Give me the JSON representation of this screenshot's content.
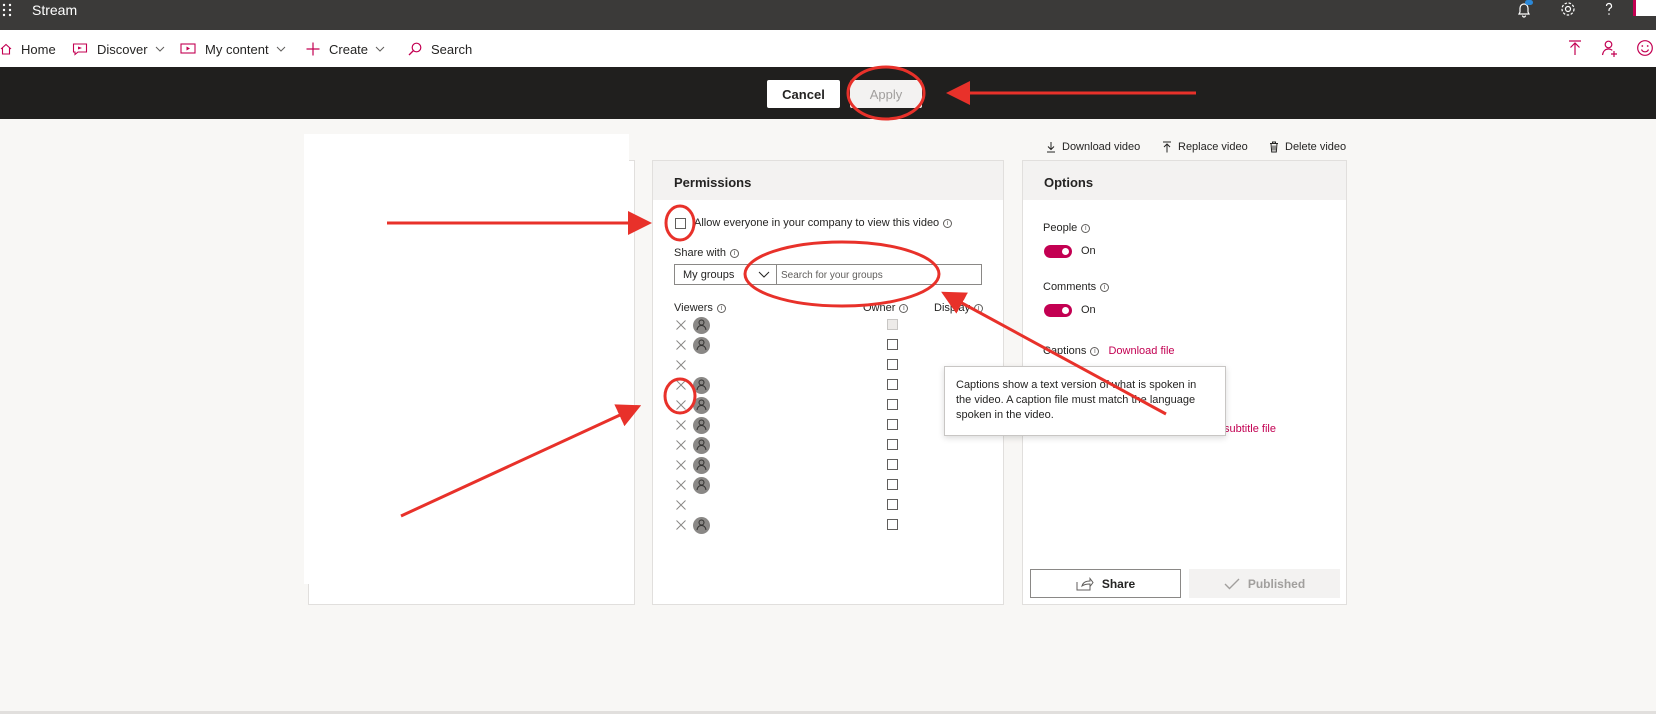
{
  "app": {
    "title": "Stream",
    "notification_count": "1"
  },
  "nav": {
    "home": "Home",
    "discover": "Discover",
    "my_content": "My content",
    "create": "Create",
    "search": "Search"
  },
  "command": {
    "cancel": "Cancel",
    "apply": "Apply"
  },
  "video_actions": {
    "download": "Download video",
    "replace": "Replace video",
    "delete": "Delete video"
  },
  "permissions": {
    "title": "Permissions",
    "allow_everyone": "Allow everyone in your company to view this video",
    "share_with": "Share with",
    "share_type": "My groups",
    "search_placeholder": "Search for your groups",
    "viewers_label": "Viewers",
    "owner_label": "Owner",
    "display_label": "Display"
  },
  "options": {
    "title": "Options",
    "people_label": "People",
    "people_state": "On",
    "comments_label": "Comments",
    "comments_state": "On",
    "captions_label": "Captions",
    "download_file": "Download file",
    "subtitle_file": "subtitle file",
    "share": "Share",
    "published": "Published"
  },
  "tooltip": {
    "text": "Captions show a text version of what is spoken in the video. A caption file must match the language spoken in the video."
  },
  "colors": {
    "accent": "#c30052",
    "annotation": "#e8312a"
  },
  "icons": [
    "waffle-icon",
    "bell-icon",
    "gear-icon",
    "help-icon",
    "home-icon",
    "discover-icon",
    "my-content-icon",
    "plus-icon",
    "search-icon",
    "upload-icon",
    "add-person-icon",
    "smiley-icon",
    "download-icon",
    "upload-arrow-icon",
    "trash-icon",
    "close-icon",
    "person-icon",
    "share-icon",
    "check-icon"
  ]
}
